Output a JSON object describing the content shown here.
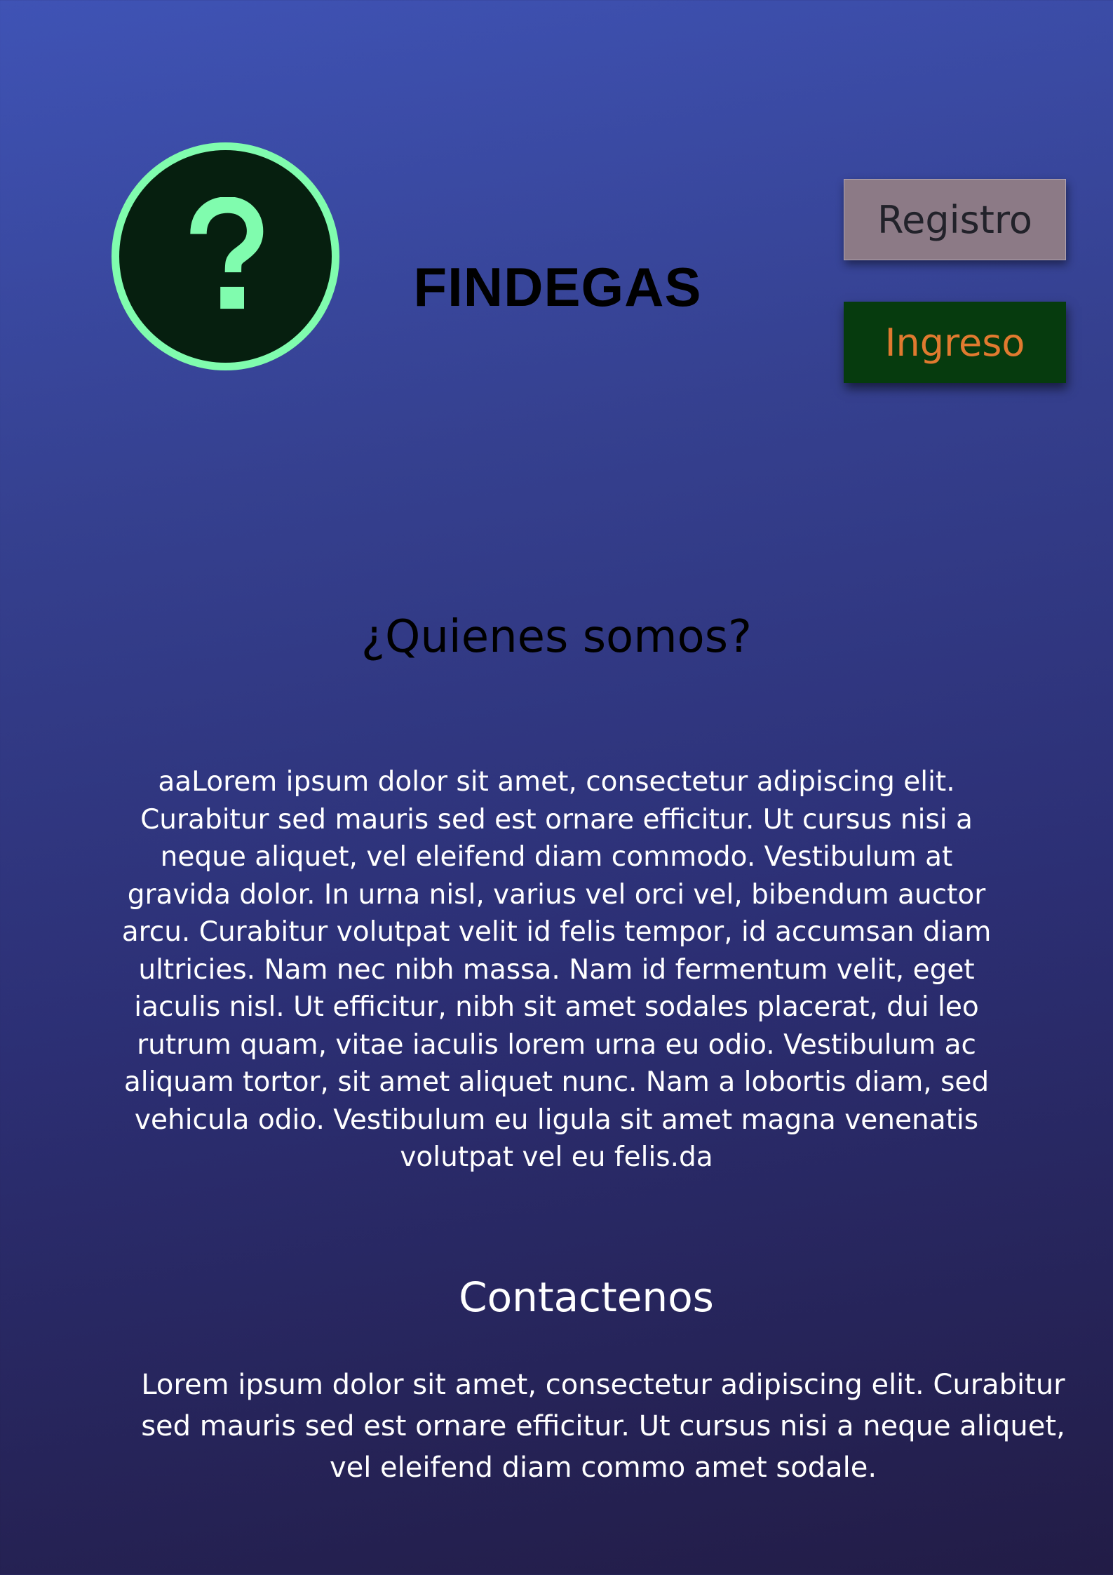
{
  "header": {
    "logo": {
      "icon": "question-mark-icon",
      "ring_color": "#80fcae",
      "fill_color": "#061f0f"
    },
    "brand": "FINDEGAS",
    "buttons": {
      "register_label": "Registro",
      "login_label": "Ingreso"
    }
  },
  "about": {
    "title": "¿Quienes somos?",
    "text": "aaLorem ipsum dolor sit amet, consectetur adipiscing elit. Curabitur sed mauris sed est ornare efficitur. Ut cursus nisi a neque aliquet, vel eleifend diam commodo. Vestibulum at gravida dolor. In urna nisl, varius vel orci vel, bibendum auctor arcu. Curabitur volutpat velit id felis tempor, id accumsan diam ultricies. Nam nec nibh massa. Nam id fermentum velit, eget iaculis nisl. Ut efficitur, nibh sit amet sodales placerat, dui leo rutrum quam, vitae iaculis lorem urna eu odio. Vestibulum ac aliquam tortor, sit amet aliquet nunc. Nam a lobortis diam, sed vehicula odio. Vestibulum eu ligula sit amet magna venenatis volutpat vel eu felis.da"
  },
  "contact": {
    "title": "Contactenos",
    "text": "Lorem ipsum dolor sit amet, consectetur adipiscing elit. Curabitur sed mauris sed est ornare efficitur. Ut cursus nisi a neque aliquet, vel eleifend diam commo amet sodale."
  },
  "colors": {
    "background_top": "#3f53b5",
    "background_bottom": "#221c46",
    "register_button": "#8c7a86",
    "login_button": "#063b0e",
    "login_text": "#e07a2f"
  }
}
